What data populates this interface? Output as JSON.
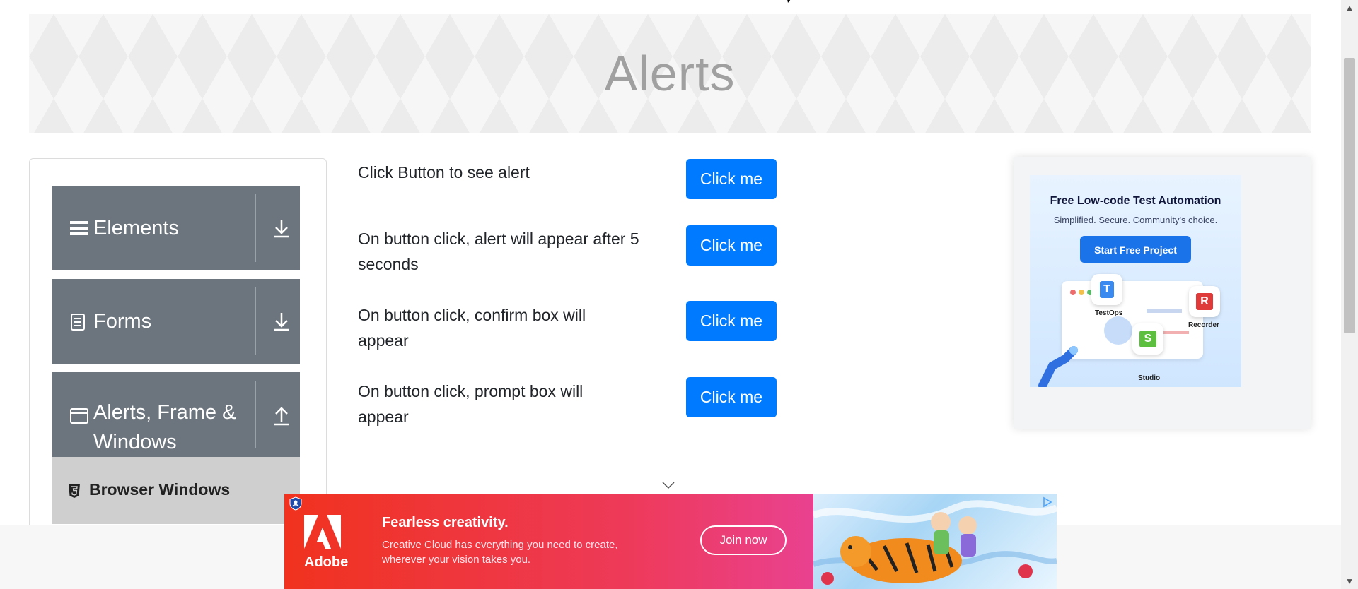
{
  "page": {
    "title": "Alerts"
  },
  "sidebar": {
    "groups": [
      {
        "label": "Elements",
        "icon": "hamburger-icon",
        "toggle_icon": "download-arrow-icon",
        "expanded": false
      },
      {
        "label": "Forms",
        "icon": "document-icon",
        "toggle_icon": "download-arrow-icon",
        "expanded": false
      },
      {
        "label": "Alerts, Frame & Windows",
        "label_line1": "Alerts, Frame &",
        "label_line2": "Windows",
        "icon": "window-icon",
        "toggle_icon": "upload-arrow-icon",
        "expanded": true
      }
    ],
    "active_item": {
      "label": "Browser Windows",
      "icon": "html5-icon"
    }
  },
  "alerts": [
    {
      "text": "Click Button to see alert",
      "button": "Click me"
    },
    {
      "text_line1": "On button click, alert will appear after 5",
      "text_line2": "seconds",
      "button": "Click me"
    },
    {
      "text_line1": "On button click, confirm box will",
      "text_line2": "appear",
      "button": "Click me"
    },
    {
      "text_line1": "On button click, prompt box will",
      "text_line2": "appear",
      "button": "Click me"
    }
  ],
  "ad_right": {
    "title": "Free Low-code Test Automation",
    "subtitle": "Simplified. Secure. Community's choice.",
    "cta": "Start Free Project",
    "apps": [
      "TestOps",
      "Recorder",
      "Studio"
    ],
    "app_letters": [
      "T",
      "R",
      "S"
    ]
  },
  "ad_bottom": {
    "brand": "Adobe",
    "headline": "Fearless creativity.",
    "body_line1": "Creative Cloud has everything you need to create,",
    "body_line2": "wherever your vision takes you.",
    "cta": "Join now"
  },
  "colors": {
    "primary": "#007bff",
    "sidebar_header": "#6c757d",
    "sidebar_active": "#cfcfcf",
    "banner_title": "#a0a0a0"
  }
}
